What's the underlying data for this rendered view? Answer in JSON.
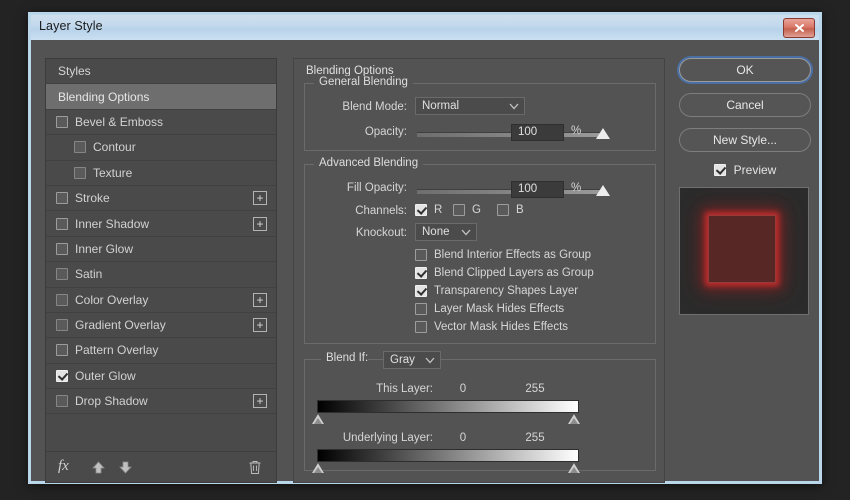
{
  "window": {
    "title": "Layer Style",
    "close_label": "close-window"
  },
  "styles_panel": {
    "header": "Styles",
    "selected": "Blending Options",
    "items": [
      {
        "label": "Bevel & Emboss",
        "checked": false,
        "indent": false,
        "plus": false
      },
      {
        "label": "Contour",
        "checked": false,
        "indent": true,
        "plus": false
      },
      {
        "label": "Texture",
        "checked": false,
        "indent": true,
        "plus": false
      },
      {
        "label": "Stroke",
        "checked": false,
        "indent": false,
        "plus": true
      },
      {
        "label": "Inner Shadow",
        "checked": false,
        "indent": false,
        "plus": true
      },
      {
        "label": "Inner Glow",
        "checked": false,
        "indent": false,
        "plus": false
      },
      {
        "label": "Satin",
        "checked": false,
        "indent": false,
        "plus": false
      },
      {
        "label": "Color Overlay",
        "checked": false,
        "indent": false,
        "plus": true
      },
      {
        "label": "Gradient Overlay",
        "checked": false,
        "indent": false,
        "plus": true
      },
      {
        "label": "Pattern Overlay",
        "checked": false,
        "indent": false,
        "plus": false
      },
      {
        "label": "Outer Glow",
        "checked": true,
        "indent": false,
        "plus": false
      },
      {
        "label": "Drop Shadow",
        "checked": false,
        "indent": false,
        "plus": true
      }
    ],
    "footer": {
      "fx": "fx",
      "move_up": "move-up",
      "move_down": "move-down",
      "delete": "delete-effect"
    }
  },
  "options": {
    "blending_options_title": "Blending Options",
    "general_blending": {
      "legend": "General Blending",
      "blend_mode_label": "Blend Mode:",
      "blend_mode_value": "Normal",
      "opacity_label": "Opacity:",
      "opacity_value": "100",
      "opacity_unit": "%",
      "opacity_percent": 100
    },
    "advanced_blending": {
      "legend": "Advanced Blending",
      "fill_opacity_label": "Fill Opacity:",
      "fill_opacity_value": "100",
      "fill_opacity_unit": "%",
      "fill_opacity_percent": 100,
      "channels_label": "Channels:",
      "channels": [
        {
          "label": "R",
          "checked": true
        },
        {
          "label": "G",
          "checked": false
        },
        {
          "label": "B",
          "checked": false
        }
      ],
      "knockout_label": "Knockout:",
      "knockout_value": "None",
      "checkboxes": [
        {
          "label": "Blend Interior Effects as Group",
          "checked": false
        },
        {
          "label": "Blend Clipped Layers as Group",
          "checked": true
        },
        {
          "label": "Transparency Shapes Layer",
          "checked": true
        },
        {
          "label": "Layer Mask Hides Effects",
          "checked": false
        },
        {
          "label": "Vector Mask Hides Effects",
          "checked": false
        }
      ]
    },
    "blend_if": {
      "legend_label": "Blend If:",
      "channel_value": "Gray",
      "this_layer_label": "This Layer:",
      "this_layer_min": "0",
      "this_layer_max": "255",
      "underlying_layer_label": "Underlying Layer:",
      "underlying_layer_min": "0",
      "underlying_layer_max": "255"
    }
  },
  "actions": {
    "ok": "OK",
    "cancel": "Cancel",
    "new_style": "New Style...",
    "preview_label": "Preview",
    "preview_checked": true
  },
  "colors": {
    "dialog_bg": "#535353",
    "panel_bg": "#4a4a4a",
    "titlebar": "#c2d8ec",
    "focus_ring": "#4a6fa5",
    "glow_red": "#d62e2e"
  }
}
